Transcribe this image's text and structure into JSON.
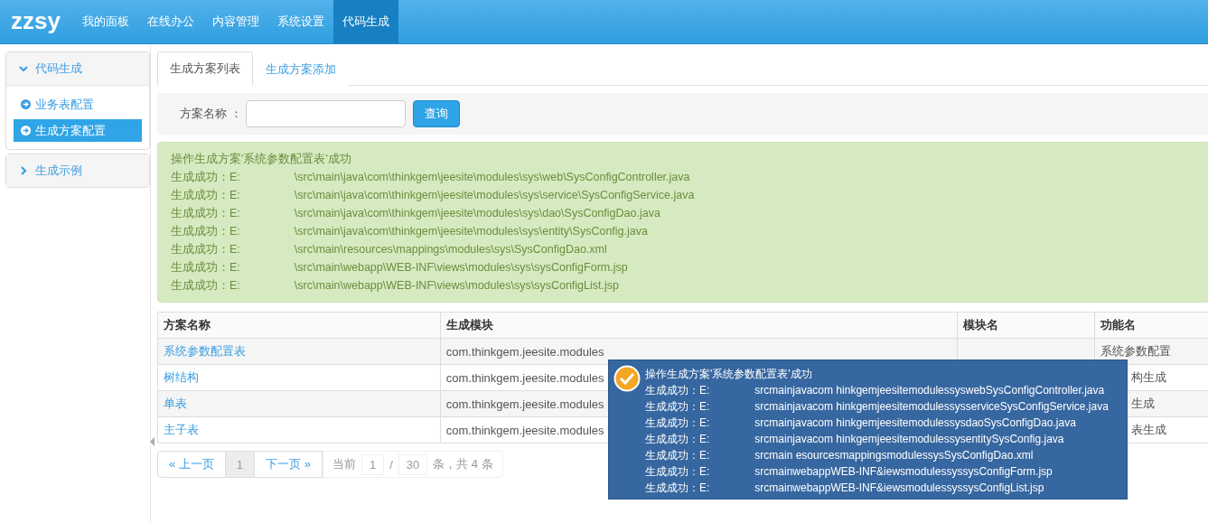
{
  "header": {
    "logo": "zzsy",
    "nav": [
      {
        "label": "我的面板",
        "selected": false
      },
      {
        "label": "在线办公",
        "selected": false
      },
      {
        "label": "内容管理",
        "selected": false
      },
      {
        "label": "系统设置",
        "selected": false
      },
      {
        "label": "代码生成",
        "selected": true
      }
    ]
  },
  "sidebar": {
    "groups": [
      {
        "title": "代码生成",
        "expanded": true,
        "items": [
          {
            "label": "业务表配置",
            "selected": false
          },
          {
            "label": "生成方案配置",
            "selected": true
          }
        ]
      },
      {
        "title": "生成示例",
        "expanded": false
      }
    ]
  },
  "tabs": [
    {
      "label": "生成方案列表",
      "selected": true
    },
    {
      "label": "生成方案添加",
      "selected": false
    }
  ],
  "search": {
    "label": "方案名称 ：",
    "button": "查询"
  },
  "alert": {
    "title": "操作生成方案'系统参数配置表'成功",
    "lines": [
      {
        "prefix": "生成成功：E:",
        "path": "\\src\\main\\java\\com\\thinkgem\\jeesite\\modules\\sys\\web\\SysConfigController.java"
      },
      {
        "prefix": "生成成功：E:",
        "path": "\\src\\main\\java\\com\\thinkgem\\jeesite\\modules\\sys\\service\\SysConfigService.java"
      },
      {
        "prefix": "生成成功：E:",
        "path": "\\src\\main\\java\\com\\thinkgem\\jeesite\\modules\\sys\\dao\\SysConfigDao.java"
      },
      {
        "prefix": "生成成功：E:",
        "path": "\\src\\main\\java\\com\\thinkgem\\jeesite\\modules\\sys\\entity\\SysConfig.java"
      },
      {
        "prefix": "生成成功：E:",
        "path": "\\src\\main\\resources\\mappings\\modules\\sys\\SysConfigDao.xml"
      },
      {
        "prefix": "生成成功：E:",
        "path": "\\src\\main\\webapp\\WEB-INF\\views\\modules\\sys\\sysConfigForm.jsp"
      },
      {
        "prefix": "生成成功：E:",
        "path": "\\src\\main\\webapp\\WEB-INF\\views\\modules\\sys\\sysConfigList.jsp"
      }
    ]
  },
  "table": {
    "columns": [
      "方案名称",
      "生成模块",
      "模块名",
      "功能名"
    ],
    "rows": [
      {
        "name": "系统参数配置表",
        "module": "com.thinkgem.jeesite.modules",
        "function": "系统参数配置"
      },
      {
        "name": "树结构",
        "module": "com.thinkgem.jeesite.modules",
        "function": "构生成"
      },
      {
        "name": "单表",
        "module": "com.thinkgem.jeesite.modules",
        "function": "生成"
      },
      {
        "name": "主子表",
        "module": "com.thinkgem.jeesite.modules",
        "function": "表生成"
      }
    ]
  },
  "pagination": {
    "prev": "« 上一页",
    "pages": [
      {
        "label": "1",
        "selected": true
      }
    ],
    "next": "下一页 »",
    "current_label": "当前",
    "page_input": "1",
    "separator": "/",
    "page_size": "30",
    "summary": "条，共 4 条"
  },
  "popup": {
    "title": "操作生成方案'系统参数配置表'成功",
    "lines": [
      {
        "prefix": "生成成功：E:",
        "path": "srcmainjavacom hinkgemjeesitemodulessyswebSysConfigController.java"
      },
      {
        "prefix": "生成成功：E:",
        "path": "srcmainjavacom hinkgemjeesitemodulessysserviceSysConfigService.java"
      },
      {
        "prefix": "生成成功：E:",
        "path": "srcmainjavacom hinkgemjeesitemodulessysdaoSysConfigDao.java"
      },
      {
        "prefix": "生成成功：E:",
        "path": "srcmainjavacom hinkgemjeesitemodulessysentitySysConfig.java"
      },
      {
        "prefix": "生成成功：E:",
        "path": "srcmain esourcesmappingsmodulessysSysConfigDao.xml"
      },
      {
        "prefix": "生成成功：E:",
        "path": "srcmainwebappWEB-INF&iewsmodulessyssysConfigForm.jsp"
      },
      {
        "prefix": "生成成功：E:",
        "path": "srcmainwebappWEB-INF&iewsmodulessyssysConfigList.jsp"
      }
    ]
  }
}
